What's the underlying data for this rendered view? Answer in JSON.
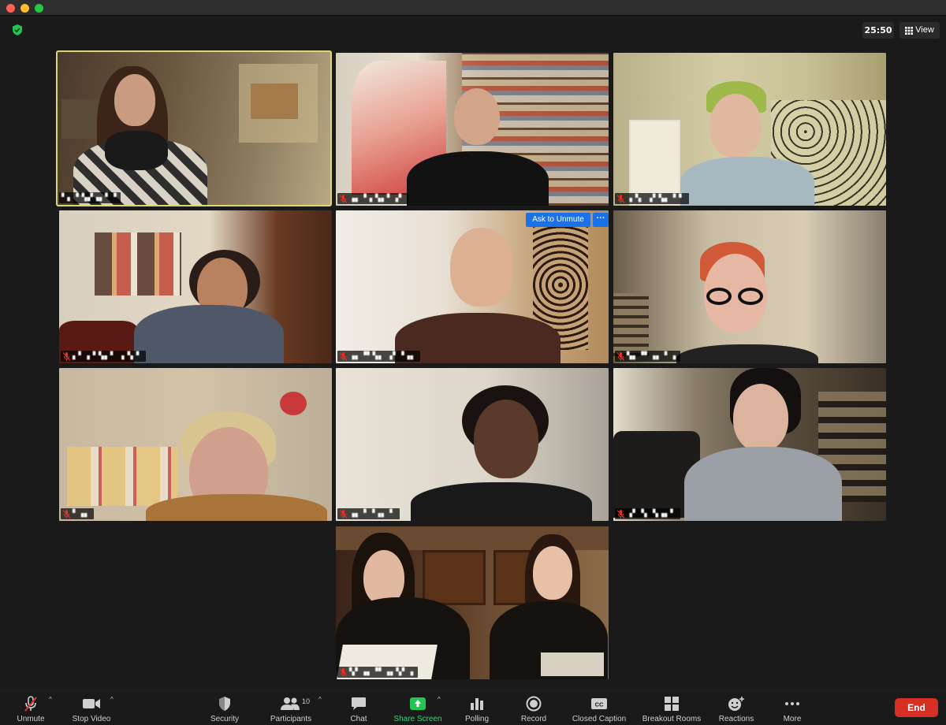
{
  "window": {
    "traffic_lights": [
      "close",
      "minimize",
      "maximize"
    ]
  },
  "top_bar": {
    "timer": "25:50",
    "view_label": "View",
    "security_status_icon": "shield-check-icon"
  },
  "tiles": [
    {
      "id": "t1",
      "name": "▘▖▝ ▚▞▗▖▘▝",
      "muted": false,
      "active": true
    },
    {
      "id": "t2",
      "name": "▗▖▝▗ ▚▖▘▗▘",
      "muted": true,
      "active": false
    },
    {
      "id": "t3",
      "name": "▗▝▖ ▗▘▚▖▝ ▘",
      "muted": true,
      "active": false
    },
    {
      "id": "t4",
      "name": "▖▘▗▝ ▚▖▘ ▗▝▖▘",
      "muted": true,
      "active": false
    },
    {
      "id": "t5",
      "name": "▗▖▝▘▚▖ ▗▘▝▗▖",
      "muted": true,
      "active": false
    },
    {
      "id": "t6",
      "name": "▚▖▝▘▗▖ ▘▗",
      "muted": true,
      "active": false
    },
    {
      "id": "t7",
      "name": "▘▗▖",
      "muted": true,
      "active": false
    },
    {
      "id": "t8",
      "name": "▗▖ ▘▝▗▖ ▘",
      "muted": true,
      "active": false
    },
    {
      "id": "t9",
      "name": "▗▘▝▖ ▚▗▖▘",
      "muted": true,
      "active": false
    },
    {
      "id": "t10",
      "name": "▚▘▗▖▝▘▗▖▚▘▗",
      "muted": true,
      "active": false
    }
  ],
  "hover_controls": {
    "ask_to_unmute": "Ask to Unmute",
    "more": "···"
  },
  "toolbar": {
    "unmute": "Unmute",
    "stop_video": "Stop Video",
    "security": "Security",
    "participants": "Participants",
    "participants_count": "10",
    "chat": "Chat",
    "share_screen": "Share Screen",
    "polling": "Polling",
    "record": "Record",
    "closed_caption": "Closed Caption",
    "breakout_rooms": "Breakout Rooms",
    "reactions": "Reactions",
    "more": "More",
    "end": "End"
  },
  "colors": {
    "accent_blue": "#1b72e8",
    "end_red": "#d62f24",
    "share_green": "#3fd37a",
    "active_speaker": "#d9d77a"
  }
}
